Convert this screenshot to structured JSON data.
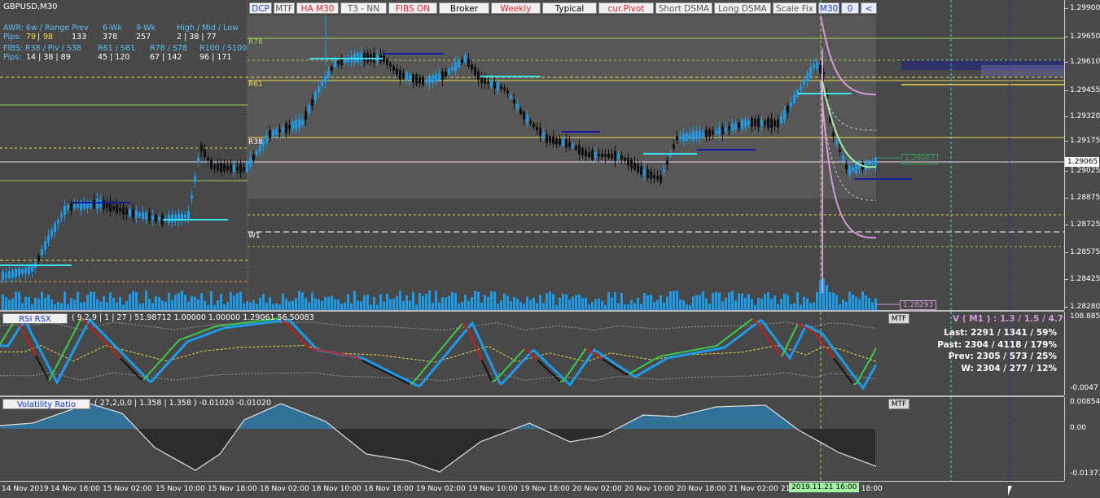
{
  "symbol": "GBPUSD,M30",
  "toolbar": [
    {
      "label": "DCP",
      "color": "#1a3cd6"
    },
    {
      "label": "MTF",
      "color": "#555555"
    },
    {
      "label": "HA M30",
      "color": "#e02020"
    },
    {
      "label": "T3 - NN",
      "color": "#555555"
    },
    {
      "label": "FIBS ON",
      "color": "#e02020"
    },
    {
      "label": "Broker",
      "color": "#000000"
    },
    {
      "label": "Weekly",
      "color": "#e02020"
    },
    {
      "label": "Typical",
      "color": "#000000"
    },
    {
      "label": "cur.Pivot",
      "color": "#e02020"
    },
    {
      "label": "Short DSMA",
      "color": "#555555"
    },
    {
      "label": "Long DSMA",
      "color": "#555555"
    },
    {
      "label": "Scale Fix",
      "color": "#555555"
    },
    {
      "label": "M30",
      "color": "#1a3cd6"
    },
    {
      "label": "0",
      "color": "#1a3cd6"
    },
    {
      "label": "<",
      "color": "#1a3cd6"
    }
  ],
  "info": {
    "awr_label": "AWR: 6w / Range",
    "pips_label": "Pips:",
    "awr_val1": "79",
    "awr_sep": "|",
    "awr_val2": "98",
    "prev_label": "Prev",
    "prev_val": "133",
    "wk6_label": "6-Wk",
    "wk6_val": "378",
    "wk9_label": "9-Wk",
    "wk9_val": "257",
    "hml_label": "High / Mid / Low",
    "hml_val": "2  |  38  |  77",
    "fibs_label": "FIBS: R38 / Piv / S38",
    "fibs_val": "14  |  38  |  89",
    "r61_label": "R61 / S61",
    "r61_val": "45  |  120",
    "r78_label": "R78 / S78",
    "r78_val": "67  |  142",
    "r100_label": "R100 / S100",
    "r100_val": "96  |  171"
  },
  "levels": {
    "r78": "R78",
    "r61": "R61",
    "r38": "R38",
    "w1": "W1"
  },
  "price_axis": [
    "1.29900",
    "1.29650",
    "1.29610",
    "1.29455",
    "1.29320",
    "1.29175",
    "1.29065",
    "1.29025",
    "1.28875",
    "1.28725",
    "1.28575",
    "1.28425",
    "1.28280"
  ],
  "price_tags": {
    "current": "1.29065",
    "level_a": "1.29087",
    "level_b": "1.28293"
  },
  "rsi": {
    "button": "RSI RSX",
    "params": "( 9,2,9 | 1 | 27 ) 51.98712 1.00000 1.00000 1.29061 56.50083",
    "mtf": "MTF",
    "axis_top": "108.8852",
    "axis_bottom": "-0.0047",
    "stats_title": "V ( M1 ) : 1.3 / 1.5 / 4.7",
    "stats": [
      "Last: 2291 / 1341 / 59%",
      "Past: 2304 / 4118 / 179%",
      "Prev: 2305 / 573 / 25%",
      "W: 2304 / 277 / 12%"
    ]
  },
  "vr": {
    "button": "Volatility Ratio",
    "params": "( 27,2,0,0 | 1.358 | 1.358 ) -0.01020 -0.01020",
    "mtf": "MTF",
    "axis": [
      "0.00854",
      "0.00",
      "-0.01373"
    ]
  },
  "time_axis": [
    "14 Nov 2019",
    "14 Nov 18:00",
    "15 Nov 02:00",
    "15 Nov 10:00",
    "15 Nov 18:00",
    "18 Nov 02:00",
    "18 Nov 10:00",
    "18 Nov 18:00",
    "19 Nov 02:00",
    "19 Nov 10:00",
    "19 Nov 18:00",
    "20 Nov 02:00",
    "20 Nov 10:00",
    "20 Nov 18:00",
    "21 Nov 02:00",
    "21 Nov 10:00",
    "21 Nov 18:00"
  ],
  "time_cursor": "2019.11.21 16:00",
  "colors": {
    "bull": "#1e9be8",
    "bear": "#111111",
    "pivot": "#e8d84a",
    "green": "#9acd58",
    "pink": "#d49ad8",
    "cyan": "#3ee0ec",
    "navy": "#1a1aa0"
  }
}
